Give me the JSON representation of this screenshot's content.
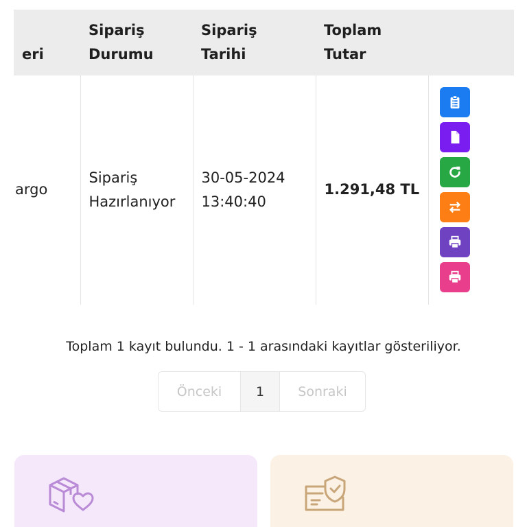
{
  "table": {
    "headers": {
      "cut": "eri",
      "status_line1": "Sipariş",
      "status_line2": "Durumu",
      "date_line1": "Sipariş",
      "date_line2": "Tarihi",
      "total_line1": "Toplam",
      "total_line2": "Tutar"
    },
    "rows": [
      {
        "cut": "argo",
        "status_line1": "Sipariş",
        "status_line2": "Hazırlanıyor",
        "date": "30-05-2024",
        "time": "13:40:40",
        "total": "1.291,48 TL"
      }
    ],
    "actions": [
      {
        "icon": "clipboard-list-icon",
        "color": "#1a7cf0"
      },
      {
        "icon": "document-icon",
        "color": "#7a1df0"
      },
      {
        "icon": "refresh-icon",
        "color": "#28a745"
      },
      {
        "icon": "exchange-icon",
        "color": "#fd7e14"
      },
      {
        "icon": "print-icon",
        "color": "#6f42c1"
      },
      {
        "icon": "print-icon",
        "color": "#e83e8c"
      }
    ]
  },
  "summary": "Toplam 1 kayıt bulundu. 1 - 1 arasındaki kayıtlar gösteriliyor.",
  "pagination": {
    "prev": "Önceki",
    "current": "1",
    "next": "Sonraki"
  },
  "cards": [
    {
      "icon": "box-heart-icon",
      "color": "#f5e8fb",
      "icon_color": "#b98ad6"
    },
    {
      "icon": "card-shield-icon",
      "color": "#fbf1e4",
      "icon_color": "#c9a679"
    }
  ]
}
